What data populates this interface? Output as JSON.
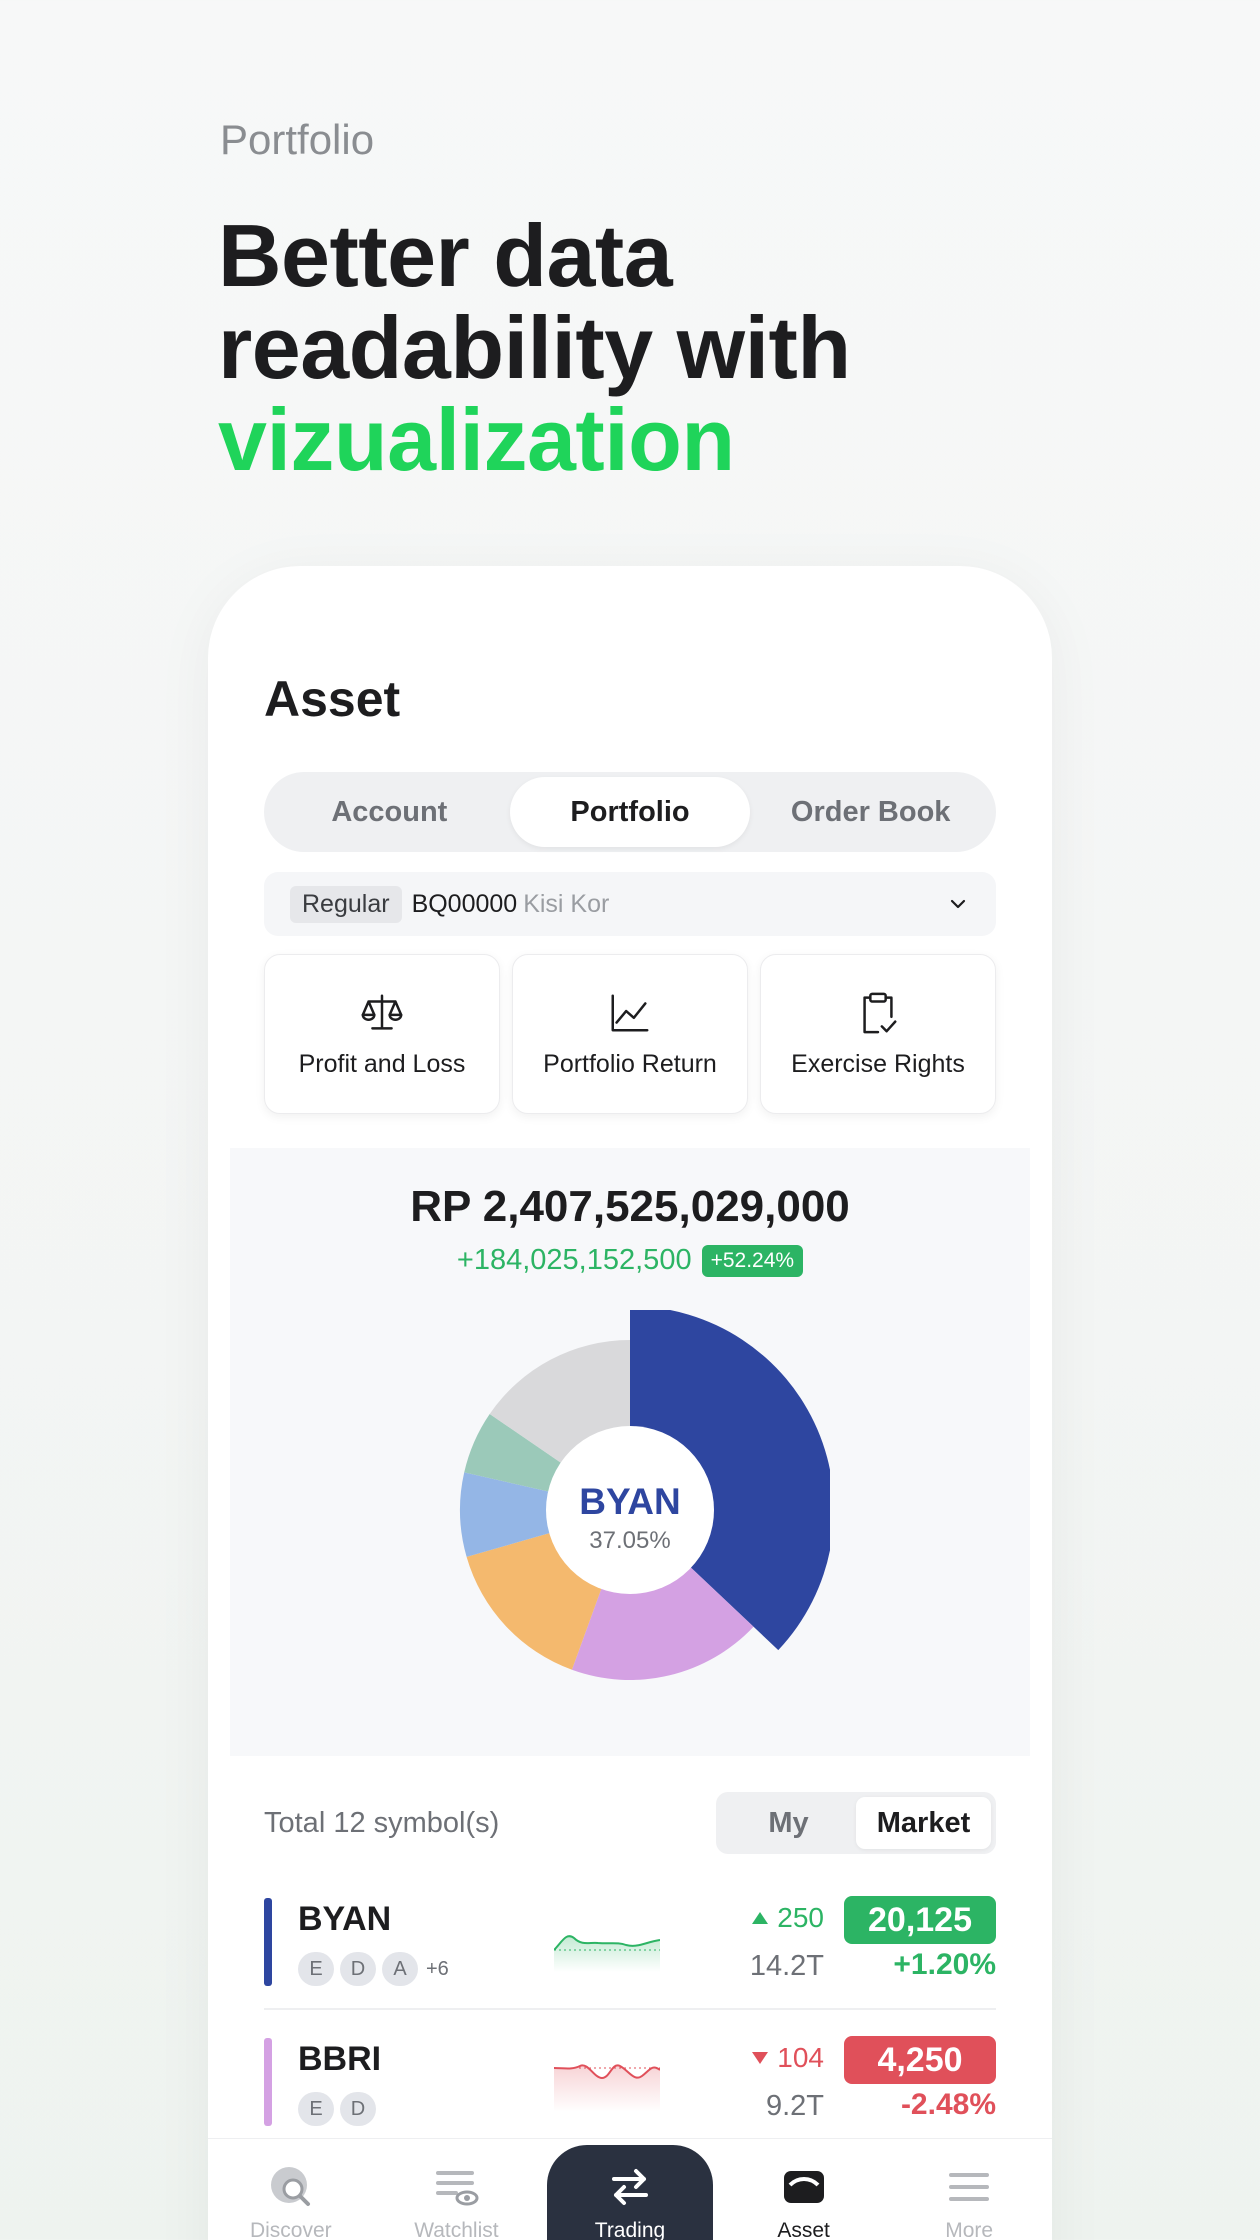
{
  "hero": {
    "eyebrow": "Portfolio",
    "headline_line1": "Better data",
    "headline_line2": "readability with",
    "headline_accent": "vizualization"
  },
  "screen": {
    "title": "Asset",
    "tabs": [
      {
        "label": "Account",
        "active": false
      },
      {
        "label": "Portfolio",
        "active": true
      },
      {
        "label": "Order Book",
        "active": false
      }
    ],
    "account": {
      "type": "Regular",
      "number": "BQ00000",
      "name": "Kisi Kor"
    },
    "quick_actions": [
      {
        "label": "Profit and Loss",
        "icon": "scale-icon"
      },
      {
        "label": "Portfolio Return",
        "icon": "line-chart-icon"
      },
      {
        "label": "Exercise Rights",
        "icon": "clipboard-check-icon"
      }
    ],
    "summary": {
      "total": "RP 2,407,525,029,000",
      "gain": "+184,025,152,500",
      "gain_pct": "+52.24%"
    },
    "donut_center": {
      "symbol": "BYAN",
      "pct": "37.05%"
    },
    "symbols": {
      "count_label": "Total 12 symbol(s)",
      "toggle": [
        "My",
        "Market"
      ],
      "active_toggle": "Market"
    },
    "holdings": [
      {
        "symbol": "BYAN",
        "color": "#2e46a0",
        "badges": [
          "E",
          "D",
          "A"
        ],
        "more": "+6",
        "change": "250",
        "direction": "up",
        "volume": "14.2T",
        "price": "20,125",
        "pct": "+1.20%",
        "trend": "up"
      },
      {
        "symbol": "BBRI",
        "color": "#d4a1e3",
        "badges": [
          "E",
          "D"
        ],
        "more": "",
        "change": "104",
        "direction": "down",
        "volume": "9.2T",
        "price": "4,250",
        "pct": "-2.48%",
        "trend": "down"
      }
    ],
    "nav": [
      {
        "label": "Discover",
        "icon": "discover-icon"
      },
      {
        "label": "Watchlist",
        "icon": "watchlist-icon"
      },
      {
        "label": "Trading",
        "icon": "swap-arrows-icon"
      },
      {
        "label": "Asset",
        "icon": "wallet-icon"
      },
      {
        "label": "More",
        "icon": "menu-icon"
      }
    ],
    "nav_active": "Asset"
  },
  "colors": {
    "accent_green": "#1fd45a",
    "up": "#2cb464",
    "down": "#e0505a",
    "nav_dark": "#2a3140"
  },
  "chart_data": {
    "type": "pie",
    "donut": true,
    "slices": [
      {
        "label": "BYAN",
        "value": 37.05,
        "color": "#2e46a0"
      },
      {
        "label": "",
        "value": 18.5,
        "color": "#d4a1e3"
      },
      {
        "label": "",
        "value": 15.0,
        "color": "#f4b96e"
      },
      {
        "label": "",
        "value": 8.0,
        "color": "#94b6e6"
      },
      {
        "label": "",
        "value": 6.0,
        "color": "#9bc9b9"
      },
      {
        "label": "",
        "value": 15.45,
        "color": "#d9d9db"
      }
    ]
  }
}
